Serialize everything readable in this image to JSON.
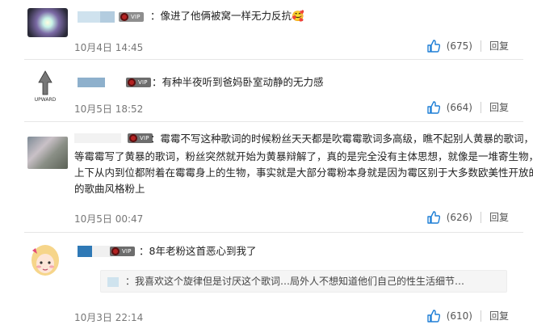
{
  "comments": [
    {
      "vip_label": "VIP",
      "text": "：像进了他俩被窝一样无力反抗🥰",
      "time": "10月4日 14:45",
      "likes": "(675)",
      "reply_label": "回复",
      "avatar_icon": "glowing-light-avatar-icon"
    },
    {
      "vip_label": "VIP",
      "avatar_text": "UPWARD",
      "text": "：有种半夜听到爸妈卧室动静的无力感",
      "time": "10月5日 18:52",
      "likes": "(664)",
      "reply_label": "回复",
      "avatar_icon": "upward-arrow-avatar-icon"
    },
    {
      "vip_label": "VIP",
      "text_lines": [
        "：霉霉不写这种歌词的时候粉丝天天都是吹霉霉歌词多高级，瞧不起别人黄暴的歌词，",
        "等霉霉写了黄暴的歌词，粉丝突然就开始为黄暴辩解了，真的是完全没有主体思想，就像是一堆寄生物，全身",
        "上下从内到位都附着在霉霉身上的生物，事实就是大部分霉粉本身就是因为霉区别于大多数欧美性开放的歌手",
        "的歌曲风格粉上"
      ],
      "time": "10月5日 00:47",
      "likes": "(626)",
      "reply_label": "回复",
      "avatar_icon": "photo-avatar-icon"
    },
    {
      "vip_label": "VIP",
      "text": "：8年老粉这首恶心到我了",
      "quote": "：我喜欢这个旋律但是讨厌这个歌词…局外人不想知道他们自己的性生活细节…",
      "time": "10月3日 22:14",
      "likes": "(610)",
      "reply_label": "回复",
      "avatar_icon": "cartoon-girl-avatar-icon"
    }
  ],
  "colors": {
    "mask": "#b9d3e6",
    "like_icon": "#1f7fd6",
    "text": "#222222",
    "meta": "#777777"
  }
}
